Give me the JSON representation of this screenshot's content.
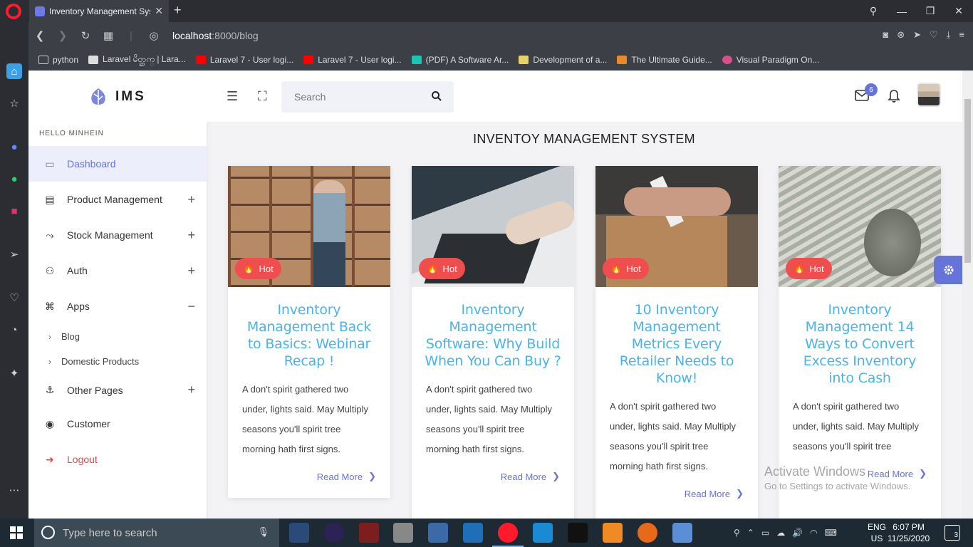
{
  "browser": {
    "tab_title": "Inventory Management Sys",
    "url_host": "localhost",
    "url_path": ":8000/blog",
    "bookmarks": [
      {
        "label": "python"
      },
      {
        "label": "Laravel မိတ္ဆက္ | Lara..."
      },
      {
        "label": "Laravel 7 - User logi..."
      },
      {
        "label": "Laravel 7 - User logi..."
      },
      {
        "label": "(PDF) A Software Ar..."
      },
      {
        "label": "Development of a..."
      },
      {
        "label": "The Ultimate Guide..."
      },
      {
        "label": "Visual Paradigm On..."
      }
    ]
  },
  "sidebar": {
    "brand": "IMS",
    "greeting": "HELLO MINHEIN",
    "items": [
      {
        "label": "Dashboard",
        "icon": "monitor-icon"
      },
      {
        "label": "Product Management",
        "icon": "archive-icon"
      },
      {
        "label": "Stock Management",
        "icon": "stock-icon"
      },
      {
        "label": "Auth",
        "icon": "user-icon"
      },
      {
        "label": "Apps",
        "icon": "command-icon"
      },
      {
        "label": "Other Pages",
        "icon": "anchor-icon"
      },
      {
        "label": "Customer",
        "icon": "person-circle-icon"
      },
      {
        "label": "Logout",
        "icon": "logout-icon"
      }
    ],
    "sub_items": [
      {
        "label": "Blog"
      },
      {
        "label": "Domestic Products"
      }
    ],
    "accent_color": "#6674d9",
    "logout_color": "#e5484d"
  },
  "topbar": {
    "search_placeholder": "Search",
    "mail_badge": "6"
  },
  "main": {
    "title": "INVENTOY MANAGEMENT SYSTEM",
    "hot_label": "Hot",
    "read_more": "Read More",
    "cards": [
      {
        "title": "Inventory Management Back to Basics: Webinar Recap !",
        "text": "A don't spirit gathered two under, lights said. May Multiply seasons you'll spirit tree morning hath first signs."
      },
      {
        "title": "Inventory Management Software: Why Build When You Can Buy ?",
        "text": "A don't spirit gathered two under, lights said. May Multiply seasons you'll spirit tree morning hath first signs."
      },
      {
        "title": "10 Inventory Management Metrics Every Retailer Needs to Know!",
        "text": "A don't spirit gathered two under, lights said. May Multiply seasons you'll spirit tree morning hath first signs."
      },
      {
        "title": "Inventory Management 14 Ways to Convert Excess Inventory into Cash",
        "text": "A don't spirit gathered two under, lights said. May Multiply seasons you'll spirit tree"
      }
    ],
    "title_color": "#4ab3e8",
    "hot_color": "#ef4e4e"
  },
  "watermark": {
    "line1": "Activate Windows",
    "line2": "Go to Settings to activate Windows."
  },
  "taskbar": {
    "search_placeholder": "Type here to search",
    "lang1": "ENG",
    "lang2": "US",
    "time": "6:07 PM",
    "date": "11/25/2020",
    "notifications": "3"
  }
}
